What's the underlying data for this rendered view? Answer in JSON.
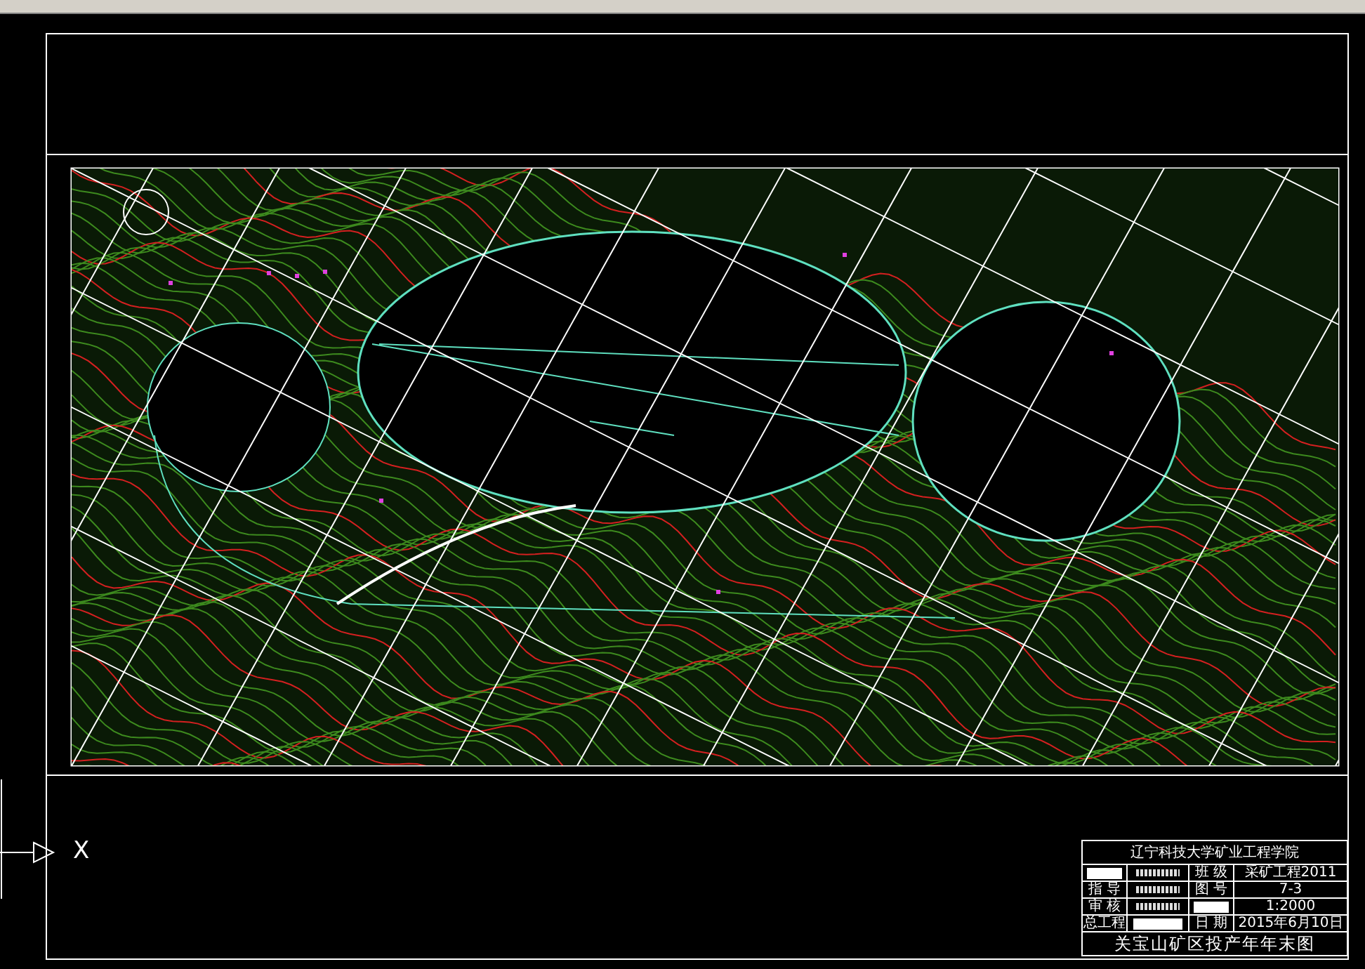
{
  "title_block": {
    "school": "辽宁科技大学矿业工程学院",
    "rows": [
      [
        {
          "kind": "redacted"
        },
        {
          "kind": "illegible"
        },
        {
          "kind": "text",
          "text": "班 级"
        },
        {
          "kind": "text",
          "text": "采矿工程2011"
        }
      ],
      [
        {
          "kind": "text",
          "text": "指 导"
        },
        {
          "kind": "illegible"
        },
        {
          "kind": "text",
          "text": "图 号"
        },
        {
          "kind": "text",
          "text": "7-3"
        }
      ],
      [
        {
          "kind": "text",
          "text": "审 核"
        },
        {
          "kind": "illegible"
        },
        {
          "kind": "redacted"
        },
        {
          "kind": "text",
          "text": "1:2000"
        }
      ],
      [
        {
          "kind": "text",
          "text": "总工程"
        },
        {
          "kind": "redacted"
        },
        {
          "kind": "text",
          "text": "日 期"
        },
        {
          "kind": "text",
          "text": "2015年6月10日"
        }
      ]
    ],
    "drawing_title": "关宝山矿区投产年年末图"
  },
  "ucs": {
    "axis_label": "X"
  }
}
